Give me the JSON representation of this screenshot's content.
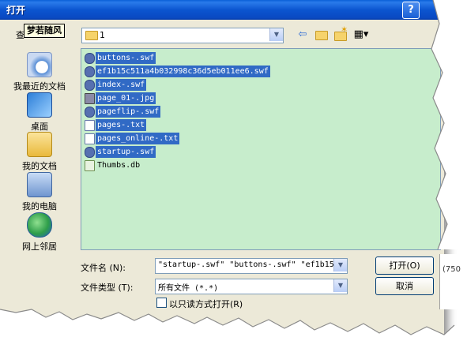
{
  "window": {
    "title": "打开",
    "help_label": "?"
  },
  "look_in": {
    "label": "查",
    "tooltip": "梦若随风",
    "value": "1"
  },
  "places": [
    {
      "label": "我最近的文档",
      "icon": "recent-documents-icon"
    },
    {
      "label": "桌面",
      "icon": "desktop-icon"
    },
    {
      "label": "我的文档",
      "icon": "my-documents-icon"
    },
    {
      "label": "我的电脑",
      "icon": "my-computer-icon"
    },
    {
      "label": "网上邻居",
      "icon": "network-places-icon"
    }
  ],
  "files": [
    {
      "name": "buttons-.swf",
      "selected": true,
      "kind": "swf"
    },
    {
      "name": "ef1b15c511a4b032998c36d5eb011ee6.swf",
      "selected": true,
      "kind": "swf"
    },
    {
      "name": "index-.swf",
      "selected": true,
      "kind": "swf"
    },
    {
      "name": "page_01-.jpg",
      "selected": true,
      "kind": "jpg"
    },
    {
      "name": "pageflip-.swf",
      "selected": true,
      "kind": "swf"
    },
    {
      "name": "pages-.txt",
      "selected": true,
      "kind": "txt"
    },
    {
      "name": "pages_online-.txt",
      "selected": true,
      "kind": "txt"
    },
    {
      "name": "startup-.swf",
      "selected": true,
      "kind": "swf"
    },
    {
      "name": "Thumbs.db",
      "selected": false,
      "kind": "db"
    }
  ],
  "filename": {
    "label": "文件名 (N):",
    "value": "\"startup-.swf\" \"buttons-.swf\" \"ef1b15c"
  },
  "filetype": {
    "label": "文件类型 (T):",
    "value": "所有文件 (*.*)"
  },
  "readonly": {
    "label": "以只读方式打开(R)",
    "checked": false
  },
  "buttons": {
    "open": "打开(O)",
    "cancel": "取消"
  },
  "side_fragment": "(750"
}
